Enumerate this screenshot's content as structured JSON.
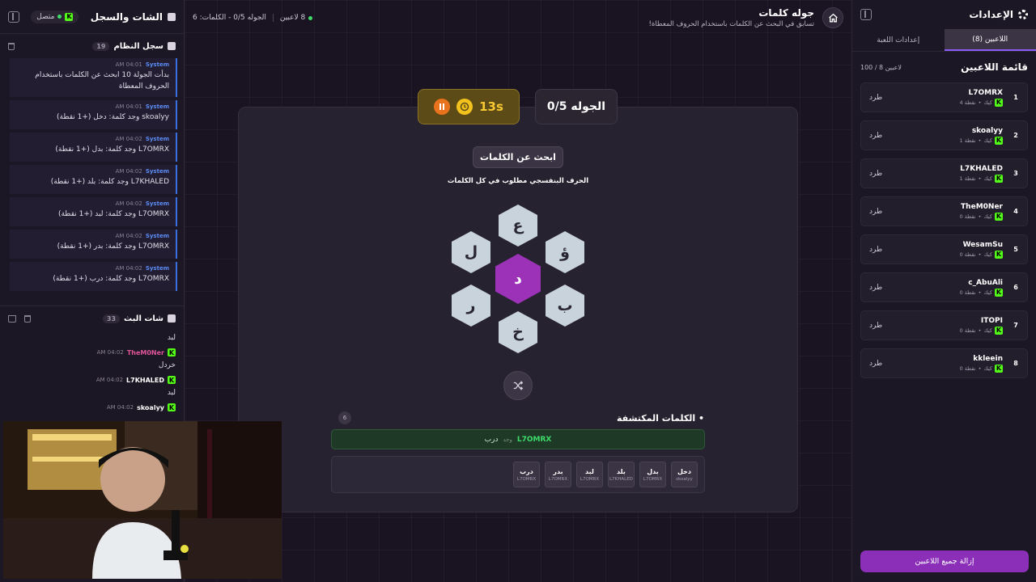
{
  "left_panel": {
    "title": "الشات والسجل",
    "connection": "متصل",
    "system_log": {
      "title": "سجل النظام",
      "count": "19",
      "entries": [
        {
          "author": "System",
          "time": "AM 04:01",
          "text": "بدأت الجولة 10 ابحث عن الكلمات باستخدام الحروف المعطاة"
        },
        {
          "author": "System",
          "time": "AM 04:01",
          "text": "skoalyy وجد كلمة: دخل (+1 نقطة)"
        },
        {
          "author": "System",
          "time": "AM 04:02",
          "text": "L7OMRX وجد كلمة: بدل (+1 نقطة)"
        },
        {
          "author": "System",
          "time": "AM 04:02",
          "text": "L7KHALED وجد كلمة: بلد (+1 نقطة)"
        },
        {
          "author": "System",
          "time": "AM 04:02",
          "text": "L7OMRX وجد كلمة: لبد (+1 نقطة)"
        },
        {
          "author": "System",
          "time": "AM 04:02",
          "text": "L7OMRX وجد كلمة: بدر (+1 نقطة)"
        },
        {
          "author": "System",
          "time": "AM 04:02",
          "text": "L7OMRX وجد كلمة: درب (+1 نقطة)"
        }
      ]
    },
    "stream_chat": {
      "title": "شات البث",
      "count": "33",
      "top_text": "لبد",
      "messages": [
        {
          "user": "TheM0Ner",
          "time": "AM 04:02",
          "text": "خردل",
          "color": "#e0559a"
        },
        {
          "user": "L7KHALED",
          "time": "AM 04:02",
          "text": "لبد",
          "color": "#ffffff"
        },
        {
          "user": "skoalyy",
          "time": "AM 04:02",
          "text": "",
          "color": "#ffffff"
        }
      ]
    }
  },
  "topbar": {
    "title": "جوله كلمات",
    "subtitle": "تسابق في البحث عن الكلمات باستخدام الحروف المعطاة!",
    "players": "8 لاعبين",
    "status": "الجوله 0/5 - الكلمات: 6"
  },
  "game": {
    "round_label": "الجوله 0/5",
    "timer": "13s",
    "search_label": "ابحث عن الكلمات",
    "hint": "الحرف البنفسجي مطلوب في كل الكلمات",
    "letters": {
      "center": "د",
      "top": "ع",
      "top_right": "ؤ",
      "bottom_right": "ب",
      "bottom": "خ",
      "bottom_left": "ر",
      "top_left": "ل"
    },
    "found_title": "الكلمات المكتشفة",
    "found_count": "6",
    "last_found": {
      "user": "L7OMRX",
      "sep": "وجد",
      "word": "درب"
    },
    "found_words": [
      {
        "word": "دخل",
        "user": "skoalyy"
      },
      {
        "word": "بدل",
        "user": "L7OMRX"
      },
      {
        "word": "بلد",
        "user": "L7KHALED"
      },
      {
        "word": "لبد",
        "user": "L7OMRX"
      },
      {
        "word": "بدر",
        "user": "L7OMRX"
      },
      {
        "word": "درب",
        "user": "L7OMRX"
      }
    ]
  },
  "right_panel": {
    "title": "الإعدادات",
    "tab_players": "اللاعبين (8)",
    "tab_game_settings": "إعدادات اللعبة",
    "list_title": "قائمة اللاعبين",
    "list_count": "100 / 8 لاعبين",
    "kick_label": "طرد",
    "platform": "كيك",
    "players": [
      {
        "rank": "1",
        "name": "L7OMRX",
        "points": "4 نقطة"
      },
      {
        "rank": "2",
        "name": "skoalyy",
        "points": "1 نقطة"
      },
      {
        "rank": "3",
        "name": "L7KHALED",
        "points": "1 نقطة"
      },
      {
        "rank": "4",
        "name": "TheM0Ner",
        "points": "0 نقطة"
      },
      {
        "rank": "5",
        "name": "WesamSu",
        "points": "0 نقطة"
      },
      {
        "rank": "6",
        "name": "c_AbuAli",
        "points": "0 نقطة"
      },
      {
        "rank": "7",
        "name": "ITOPI",
        "points": "0 نقطة"
      },
      {
        "rank": "8",
        "name": "kkleein",
        "points": "0 نقطة"
      }
    ],
    "remove_all": "إزالة جميع اللاعبين"
  },
  "colors": {
    "accent": "#8b2fb8",
    "center_hex": "#9b32b8",
    "kick_green": "#53fc18",
    "timer": "#f7c832",
    "system": "#5b8cf5"
  },
  "icons": [
    "home-icon",
    "gear-icon",
    "clock-icon",
    "pause-icon",
    "shuffle-icon",
    "trash-icon",
    "collapse-icon",
    "chat-icon",
    "kick-icon"
  ]
}
